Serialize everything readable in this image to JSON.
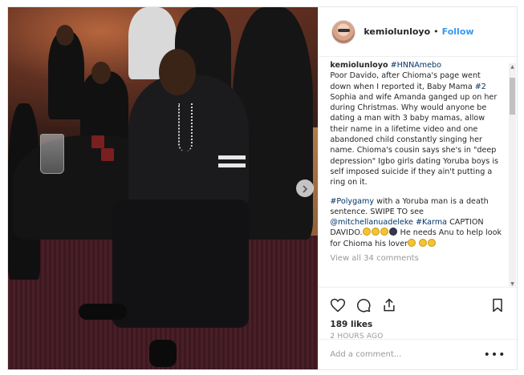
{
  "post": {
    "username": "kemiolunloyo",
    "follow_label": "Follow",
    "dot": "•",
    "caption": {
      "user": "kemiolunloyo",
      "hashtag_1": "#HNNAmebo",
      "text_1": "Poor Davido, after Chioma's page went down when I reported it, Baby Mama ",
      "hashtag_2": "#2",
      "text_2": " Sophia and wife Amanda ganged up on her during Christmas. Why would anyone be dating a man with 3 baby mamas, allow their name in a lifetime video and one abandoned child constantly singing her name. Chioma's cousin says she's in \"deep depression\" Igbo girls dating Yoruba boys is self imposed suicide if they ain't putting a ring on it.",
      "hashtag_3": "#Polygamy",
      "text_3": " with a Yoruba man is a death sentence. SWIPE TO see ",
      "mention": "@mitchellanuadeleke",
      "hashtag_4": "#Karma",
      "text_4": " CAPTION DAVIDO.",
      "text_5": " He needs Anu to help look for Chioma his lover"
    },
    "view_all_comments": "View all 34 comments",
    "likes": "189 likes",
    "time": "2 HOURS AGO",
    "add_comment_placeholder": "Add a comment...",
    "more_label": "•••"
  },
  "icons": {
    "like": "heart-icon",
    "comment": "comment-icon",
    "share": "share-icon",
    "save": "bookmark-icon",
    "next": "chevron-right-icon"
  },
  "colors": {
    "link_blue": "#3897f0",
    "hashtag": "#003569",
    "muted": "#999999",
    "text": "#262626"
  }
}
